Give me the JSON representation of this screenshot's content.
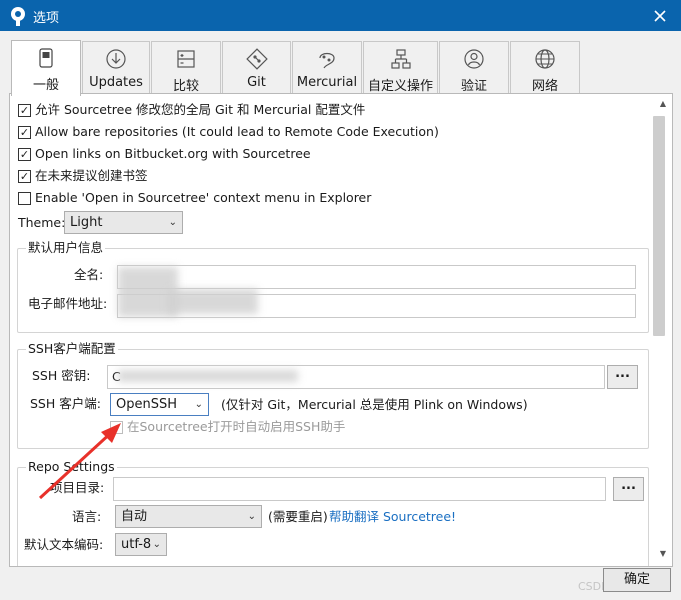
{
  "window": {
    "title": "选项",
    "close": "✕"
  },
  "tabs": [
    {
      "label": "一般",
      "icon": "switch-icon"
    },
    {
      "label": "Updates",
      "icon": "download-icon"
    },
    {
      "label": "比较",
      "icon": "diff-icon"
    },
    {
      "label": "Git",
      "icon": "git-icon"
    },
    {
      "label": "Mercurial",
      "icon": "mercurial-icon"
    },
    {
      "label": "自定义操作",
      "icon": "flowchart-icon"
    },
    {
      "label": "验证",
      "icon": "user-icon"
    },
    {
      "label": "网络",
      "icon": "globe-icon"
    }
  ],
  "options": [
    {
      "label": "允许 Sourcetree 修改您的全局 Git 和 Mercurial 配置文件",
      "checked": true
    },
    {
      "label": "Allow bare repositories (It could lead to Remote Code Execution)",
      "checked": true
    },
    {
      "label": "Open links on Bitbucket.org with Sourcetree",
      "checked": true
    },
    {
      "label": "在未来提议创建书签",
      "checked": true
    },
    {
      "label": "Enable 'Open in Sourcetree' context menu in Explorer",
      "checked": false
    }
  ],
  "theme": {
    "label": "Theme:",
    "value": "Light"
  },
  "user_info": {
    "legend": "默认用户信息",
    "fullname_label": "全名:",
    "email_label": "电子邮件地址:"
  },
  "ssh": {
    "legend": "SSH客户端配置",
    "key_label": "SSH 密钥:",
    "key_value": "C",
    "browse": "...",
    "client_label": "SSH 客户端:",
    "client_value": "OpenSSH",
    "client_note": "(仅针对 Git，Mercurial 总是使用 Plink on Windows)",
    "agent_label": "在Sourcetree打开时自动启用SSH助手",
    "agent_checked": false
  },
  "repo": {
    "legend": "Repo Settings",
    "dir_label": "项目目录:",
    "browse": "...",
    "lang_label": "语言:",
    "lang_value": "自动",
    "restart_note": "(需要重启)",
    "translate_link": "帮助翻译 Sourcetree!",
    "encoding_label": "默认文本编码:",
    "encoding_value": "utf-8"
  },
  "footer": {
    "ok": "确定",
    "watermark": "CSDN @想要飞翔"
  },
  "colors": {
    "titlebar": "#0a64ad",
    "link": "#1a6fc2",
    "annotation_arrow": "#e8312a"
  }
}
